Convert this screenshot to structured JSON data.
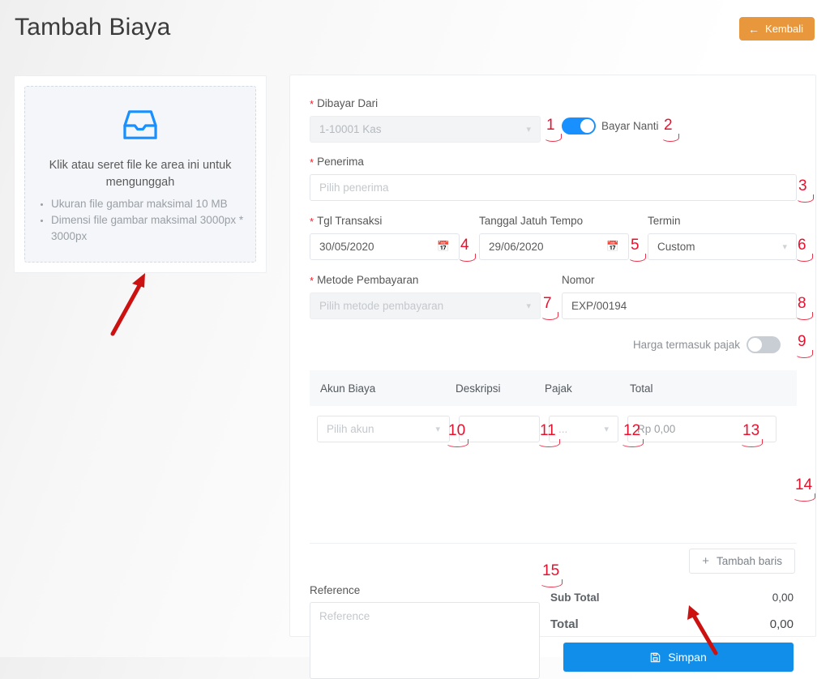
{
  "header": {
    "title": "Tambah Biaya",
    "back_label": "Kembali",
    "back_icon": "arrow-left-icon",
    "back_color": "#e8973c"
  },
  "upload": {
    "icon": "inbox-icon",
    "icon_color": "#1890ff",
    "hint": "Klik atau seret file ke area ini untuk mengunggah",
    "rules": [
      "Ukuran file gambar maksimal 10 MB",
      "Dimensi file gambar maksimal 3000px * 3000px"
    ]
  },
  "form": {
    "paid_from": {
      "label": "Dibayar Dari",
      "value": "1-10001 Kas",
      "disabled": true,
      "required": true,
      "chevron": "chevron-down-icon"
    },
    "pay_later": {
      "label": "Bayar Nanti",
      "state": "on",
      "color": "#1890ff"
    },
    "recipient": {
      "label": "Penerima",
      "placeholder": "Pilih penerima",
      "value": "",
      "required": true
    },
    "transaction_date": {
      "label": "Tgl Transaksi",
      "value": "30/05/2020",
      "required": true,
      "icon": "calendar-icon"
    },
    "due_date": {
      "label": "Tanggal Jatuh Tempo",
      "value": "29/06/2020",
      "required": false,
      "icon": "calendar-icon"
    },
    "term": {
      "label": "Termin",
      "value": "Custom",
      "required": false,
      "chevron": "chevron-down-icon"
    },
    "payment_method": {
      "label": "Metode Pembayaran",
      "placeholder": "Pilih metode pembayaran",
      "disabled": true,
      "required": true,
      "chevron": "chevron-down-icon"
    },
    "number": {
      "label": "Nomor",
      "value": "EXP/00194",
      "required": false
    },
    "price_includes_tax": {
      "label": "Harga termasuk pajak",
      "state": "off",
      "color": "#c9ced4"
    }
  },
  "line_table": {
    "columns": [
      "Akun Biaya",
      "Deskripsi",
      "Pajak",
      "Total"
    ],
    "rows": [
      {
        "account_placeholder": "Pilih akun",
        "description_value": "",
        "tax_value": "...",
        "total_value": "Rp 0,00"
      }
    ],
    "add_row_label": "Tambah baris",
    "add_row_icon": "plus-icon"
  },
  "footer": {
    "reference_label": "Reference",
    "reference_placeholder": "Reference",
    "reference_value": "",
    "sub_total_label": "Sub Total",
    "sub_total_value": "0,00",
    "total_label": "Total",
    "total_value": "0,00",
    "save_label": "Simpan",
    "save_icon": "save-icon",
    "save_color": "#108ee9"
  },
  "annotations": {
    "color": "#e8112d",
    "markers": [
      "1",
      "2",
      "3",
      "4",
      "5",
      "6",
      "7",
      "8",
      "9",
      "10",
      "11",
      "12",
      "13",
      "14",
      "15"
    ]
  }
}
